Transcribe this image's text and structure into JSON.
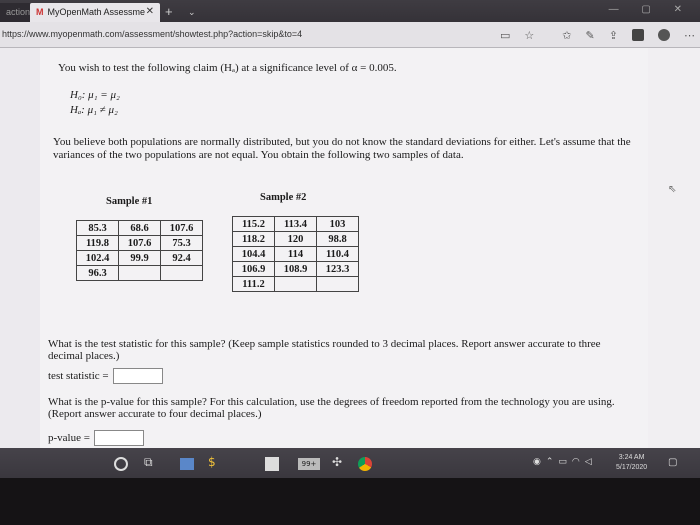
{
  "browser": {
    "prev_tab_label": "actions",
    "active_tab_icon": "M",
    "active_tab_label": "MyOpenMath Assessme",
    "close_glyph": "✕",
    "new_tab_glyph": "+",
    "url": "https://www.myopenmath.com/assessment/showtest.php?action=skip&to=4"
  },
  "problem": {
    "claim": "You wish to test the following claim (Hₐ) at a significance level of α = 0.005.",
    "h0": "H₀: μ₁ = μ₂",
    "ha": "Hₐ: μ₁ ≠ μ₂",
    "description": "You believe both populations are normally distributed, but you do not know the standard deviations for either. Let's assume that the variances of the two populations are not equal. You obtain the following two samples of data."
  },
  "samples": {
    "sample1_label": "Sample #1",
    "sample2_label": "Sample #2",
    "sample1_rows": [
      [
        "85.3",
        "68.6",
        "107.6"
      ],
      [
        "119.8",
        "107.6",
        "75.3"
      ],
      [
        "102.4",
        "99.9",
        "92.4"
      ],
      [
        "96.3",
        "",
        ""
      ]
    ],
    "sample2_rows": [
      [
        "115.2",
        "113.4",
        "103"
      ],
      [
        "118.2",
        "120",
        "98.8"
      ],
      [
        "104.4",
        "114",
        "110.4"
      ],
      [
        "106.9",
        "108.9",
        "123.3"
      ],
      [
        "111.2",
        "",
        ""
      ]
    ]
  },
  "questions": {
    "q1_text": "What is the test statistic for this sample? (Keep sample statistics rounded to 3 decimal places. Report answer accurate to three decimal places.)",
    "q1_label": "test statistic =",
    "q1_value": "",
    "q2_text": "What is the p-value for this sample? For this calculation, use the degrees of freedom reported from the technology you are using. (Report answer accurate to four decimal places.)",
    "q2_label": "p-value =",
    "q2_value": ""
  },
  "taskbar": {
    "clock_time": "3:24 AM",
    "clock_date": "5/17/2020",
    "app3_badge": "99+"
  }
}
